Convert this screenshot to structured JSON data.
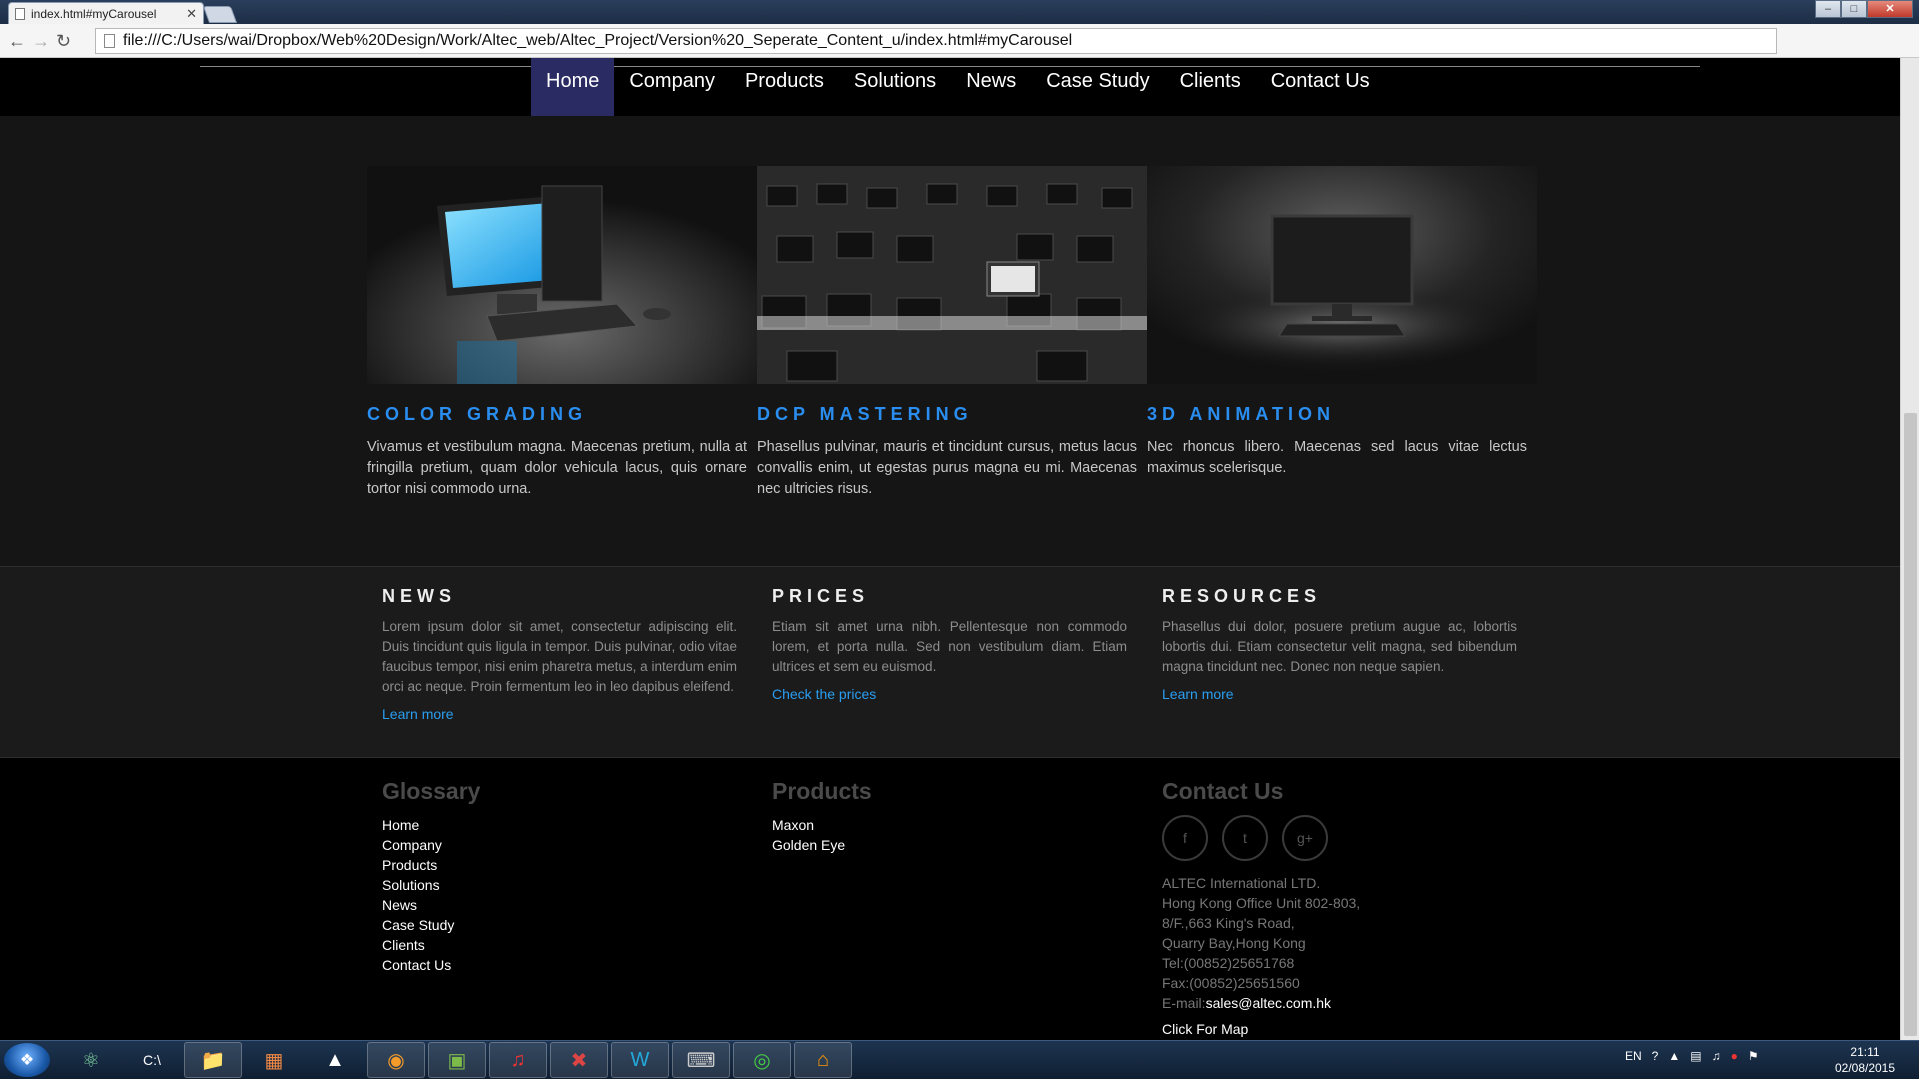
{
  "browser": {
    "tab_title": "index.html#myCarousel",
    "tab_close": "✕",
    "url": "file:///C:/Users/wai/Dropbox/Web%20Design/Work/Altec_web/Altec_Project/Version%20_Seperate_Content_u/index.html#myCarousel",
    "window_controls": {
      "minimize": "–",
      "maximize": "□",
      "close": "✕"
    }
  },
  "nav": {
    "items": [
      {
        "label": "Home",
        "active": true
      },
      {
        "label": "Company"
      },
      {
        "label": "Products"
      },
      {
        "label": "Solutions"
      },
      {
        "label": "News"
      },
      {
        "label": "Case Study"
      },
      {
        "label": "Clients"
      },
      {
        "label": "Contact Us"
      }
    ]
  },
  "services": [
    {
      "title": "COLOR GRADING",
      "text": "Vivamus et vestibulum magna. Maecenas pretium, nulla at fringilla pretium, quam dolor vehicula lacus, quis ornare tortor nisi commodo urna.",
      "image": "desktop-computer-image"
    },
    {
      "title": "DCP MASTERING",
      "text": "Phasellus pulvinar, mauris et tincidunt cursus, metus lacus convallis enim, ut egestas purus magna eu mi. Maecenas nec ultricies risus.",
      "image": "office-workstations-image"
    },
    {
      "title": "3D ANIMATION",
      "text": "Nec rhoncus libero. Maecenas sed lacus vitae lectus maximus scelerisque.",
      "image": "spotlight-monitor-image"
    }
  ],
  "info": {
    "news": {
      "title": "NEWS",
      "text": "Lorem ipsum dolor sit amet, consectetur adipiscing elit. Duis tincidunt quis ligula in tempor. Duis pulvinar, odio vitae faucibus tempor, nisi enim pharetra metus, a interdum enim orci ac neque. Proin fermentum leo in leo dapibus eleifend.",
      "link": "Learn more"
    },
    "prices": {
      "title": "PRICES",
      "text": "Etiam sit amet urna nibh. Pellentesque non commodo lorem, et porta nulla. Sed non vestibulum diam. Etiam ultrices et sem eu euismod.",
      "link": "Check the prices"
    },
    "resources": {
      "title": "RESOURCES",
      "text": "Phasellus dui dolor, posuere pretium augue ac, lobortis lobortis dui. Etiam consectetur velit magna, sed bibendum magna tincidunt nec. Donec non neque sapien.",
      "link": "Learn more"
    }
  },
  "footer": {
    "glossary": {
      "title": "Glossary",
      "links": [
        "Home",
        "Company",
        "Products",
        "Solutions",
        "News",
        "Case Study",
        "Clients",
        "Contact Us"
      ]
    },
    "products": {
      "title": "Products",
      "links": [
        "Maxon",
        "Golden Eye"
      ]
    },
    "contact": {
      "title": "Contact Us",
      "socials": [
        {
          "name": "facebook-icon",
          "glyph": "f"
        },
        {
          "name": "twitter-icon",
          "glyph": "t"
        },
        {
          "name": "google-plus-icon",
          "glyph": "g+"
        }
      ],
      "lines": [
        "ALTEC International LTD.",
        "Hong Kong Office Unit 802-803,",
        "8/F.,663 King's Road,",
        "Quarry Bay,Hong Kong",
        "Tel:(00852)25651768",
        "Fax:(00852)25651560"
      ],
      "email_label": "E-mail:",
      "email": "sales@altec.com.hk",
      "map_link": "Click For Map"
    }
  },
  "taskbar": {
    "apps": [
      "atom-icon",
      "terminal-icon",
      "file-explorer-icon",
      "windows-app-icon",
      "fox-icon",
      "firefox-icon",
      "monitor-app-icon",
      "itunes-icon",
      "mail-app-icon",
      "webstorm-icon",
      "keyboard-app-icon",
      "chrome-icon",
      "home-app-icon"
    ],
    "language": "EN",
    "time": "21:11",
    "date": "02/08/2015"
  },
  "colors": {
    "accent": "#2a8ef0",
    "nav_active": "#2a2b63",
    "link": "#2a9ef0"
  }
}
